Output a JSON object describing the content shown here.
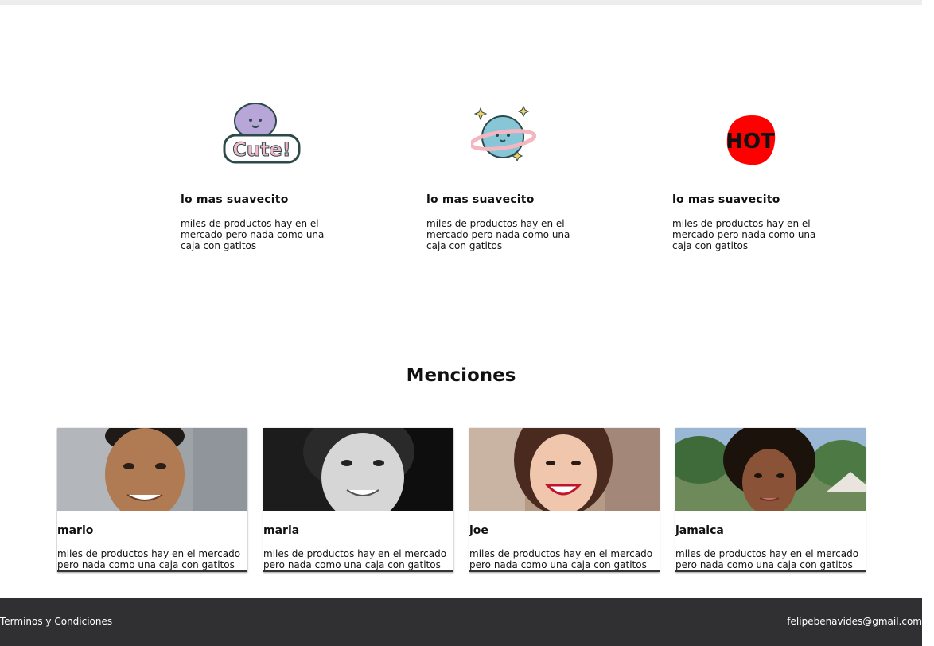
{
  "features": [
    {
      "icon": "cute-sticker-icon",
      "title": "lo mas suavecito",
      "text": "miles de productos hay en el mercado pero nada como una caja con gatitos"
    },
    {
      "icon": "planet-sticker-icon",
      "title": "lo mas suavecito",
      "text": "miles de productos hay en el mercado pero nada como una caja con gatitos"
    },
    {
      "icon": "hot-sticker-icon",
      "title": "lo mas suavecito",
      "text": "miles de productos hay en el mercado pero nada como una caja con gatitos"
    }
  ],
  "mentions": {
    "title": "Menciones",
    "cards": [
      {
        "name": "mario",
        "text": "miles de productos hay en el mercado pero nada como una caja con gatitos"
      },
      {
        "name": "maria",
        "text": "miles de productos hay en el mercado pero nada como una caja con gatitos"
      },
      {
        "name": "joe",
        "text": "miles de productos hay en el mercado pero nada como una caja con gatitos"
      },
      {
        "name": "jamaica",
        "text": "miles de productos hay en el mercado pero nada como una caja con gatitos"
      }
    ]
  },
  "footer": {
    "terms_label": "Terminos y Condiciones",
    "email": "felipebenavides@gmail.com"
  },
  "colors": {
    "footer_bg": "#303033",
    "hot_red": "#ff0000"
  }
}
